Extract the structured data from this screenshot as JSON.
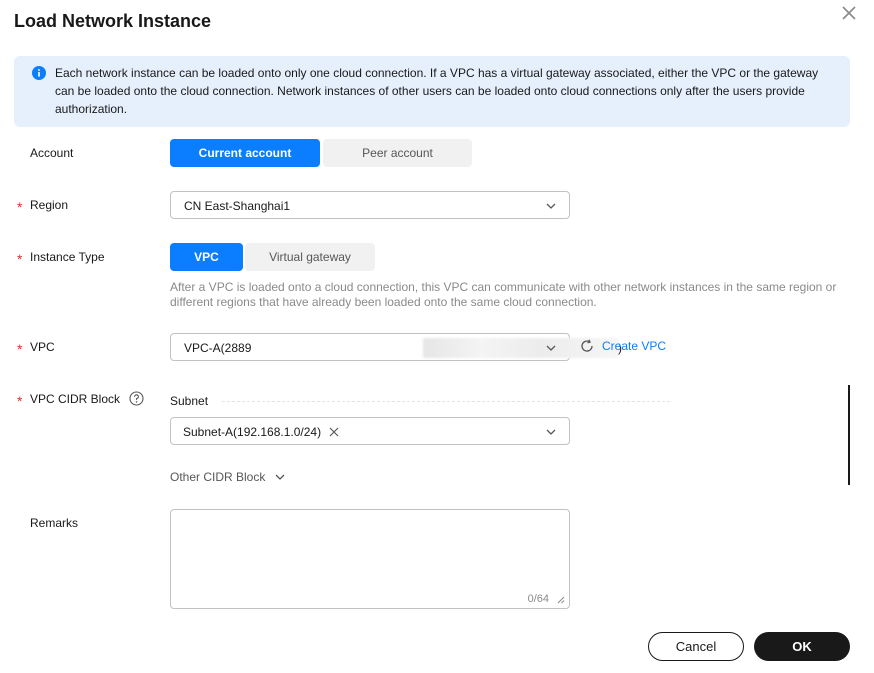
{
  "dialog": {
    "title": "Load Network Instance",
    "notice": "Each network instance can be loaded onto only one cloud connection. If a VPC has a virtual gateway associated, either the VPC or the gateway can be loaded onto the cloud connection. Network instances of other users can be loaded onto cloud connections only after the users provide authorization."
  },
  "form": {
    "account": {
      "label": "Account",
      "options": [
        "Current account",
        "Peer account"
      ],
      "selected": "Current account"
    },
    "region": {
      "label": "Region",
      "value": "CN East-Shanghai1"
    },
    "instance_type": {
      "label": "Instance Type",
      "options": [
        "VPC",
        "Virtual gateway"
      ],
      "selected": "VPC",
      "hint": "After a VPC is loaded onto a cloud connection, this VPC can communicate with other network instances in the same region or different regions that have already been loaded onto the same cloud connection."
    },
    "vpc": {
      "label": "VPC",
      "value_prefix": "VPC-A(2889",
      "value_suffix": ")",
      "create_link": "Create VPC"
    },
    "cidr": {
      "label": "VPC CIDR Block",
      "subnet_label": "Subnet",
      "subnet_tag": "Subnet-A(192.168.1.0/24)",
      "other_label": "Other CIDR Block"
    },
    "remarks": {
      "label": "Remarks",
      "counter": "0/64"
    }
  },
  "footer": {
    "cancel": "Cancel",
    "ok": "OK"
  },
  "colors": {
    "accent": "#0b7dff",
    "required": "#e0312b",
    "notice_bg": "#e6f0fd",
    "primary_button": "#191919"
  }
}
